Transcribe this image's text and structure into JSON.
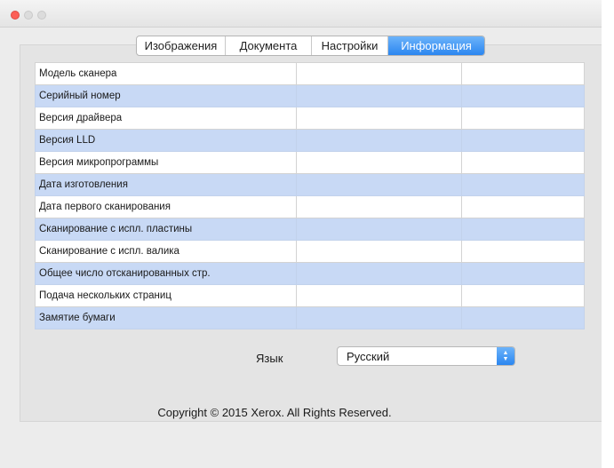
{
  "tabs": [
    {
      "label": "Изображения",
      "active": false
    },
    {
      "label": "Документа",
      "active": false
    },
    {
      "label": "Настройки",
      "active": false
    },
    {
      "label": "Информация",
      "active": true
    }
  ],
  "info_table": {
    "rows": [
      {
        "label": "Модель сканера",
        "value": "",
        "extra": ""
      },
      {
        "label": "Серийный номер",
        "value": "",
        "extra": ""
      },
      {
        "label": "Версия драйвера",
        "value": "",
        "extra": ""
      },
      {
        "label": "Версия LLD",
        "value": "",
        "extra": ""
      },
      {
        "label": "Версия микропрограммы",
        "value": "",
        "extra": ""
      },
      {
        "label": "Дата изготовления",
        "value": "",
        "extra": ""
      },
      {
        "label": "Дата первого сканирования",
        "value": "",
        "extra": ""
      },
      {
        "label": "Сканирование с испл. пластины",
        "value": "",
        "extra": ""
      },
      {
        "label": "Сканирование с испл. валика",
        "value": "",
        "extra": ""
      },
      {
        "label": "Общее число отсканированных стр.",
        "value": "",
        "extra": ""
      },
      {
        "label": "Подача нескольких страниц",
        "value": "",
        "extra": ""
      },
      {
        "label": "Замятие бумаги",
        "value": "",
        "extra": ""
      }
    ]
  },
  "language": {
    "label": "Язык",
    "selected": "Русский"
  },
  "footer": {
    "copyright": "Copyright © 2015 Xerox. All Rights Reserved."
  },
  "colors": {
    "accent": "#2b86f0",
    "row_stripe": "#c8d9f5",
    "close_button": "#fc5f57"
  },
  "icons": {
    "window_close": "close-dot-icon",
    "window_minimize": "minimize-dot-icon",
    "window_zoom": "zoom-dot-icon",
    "select_stepper": "up-down-chevron-icon"
  }
}
